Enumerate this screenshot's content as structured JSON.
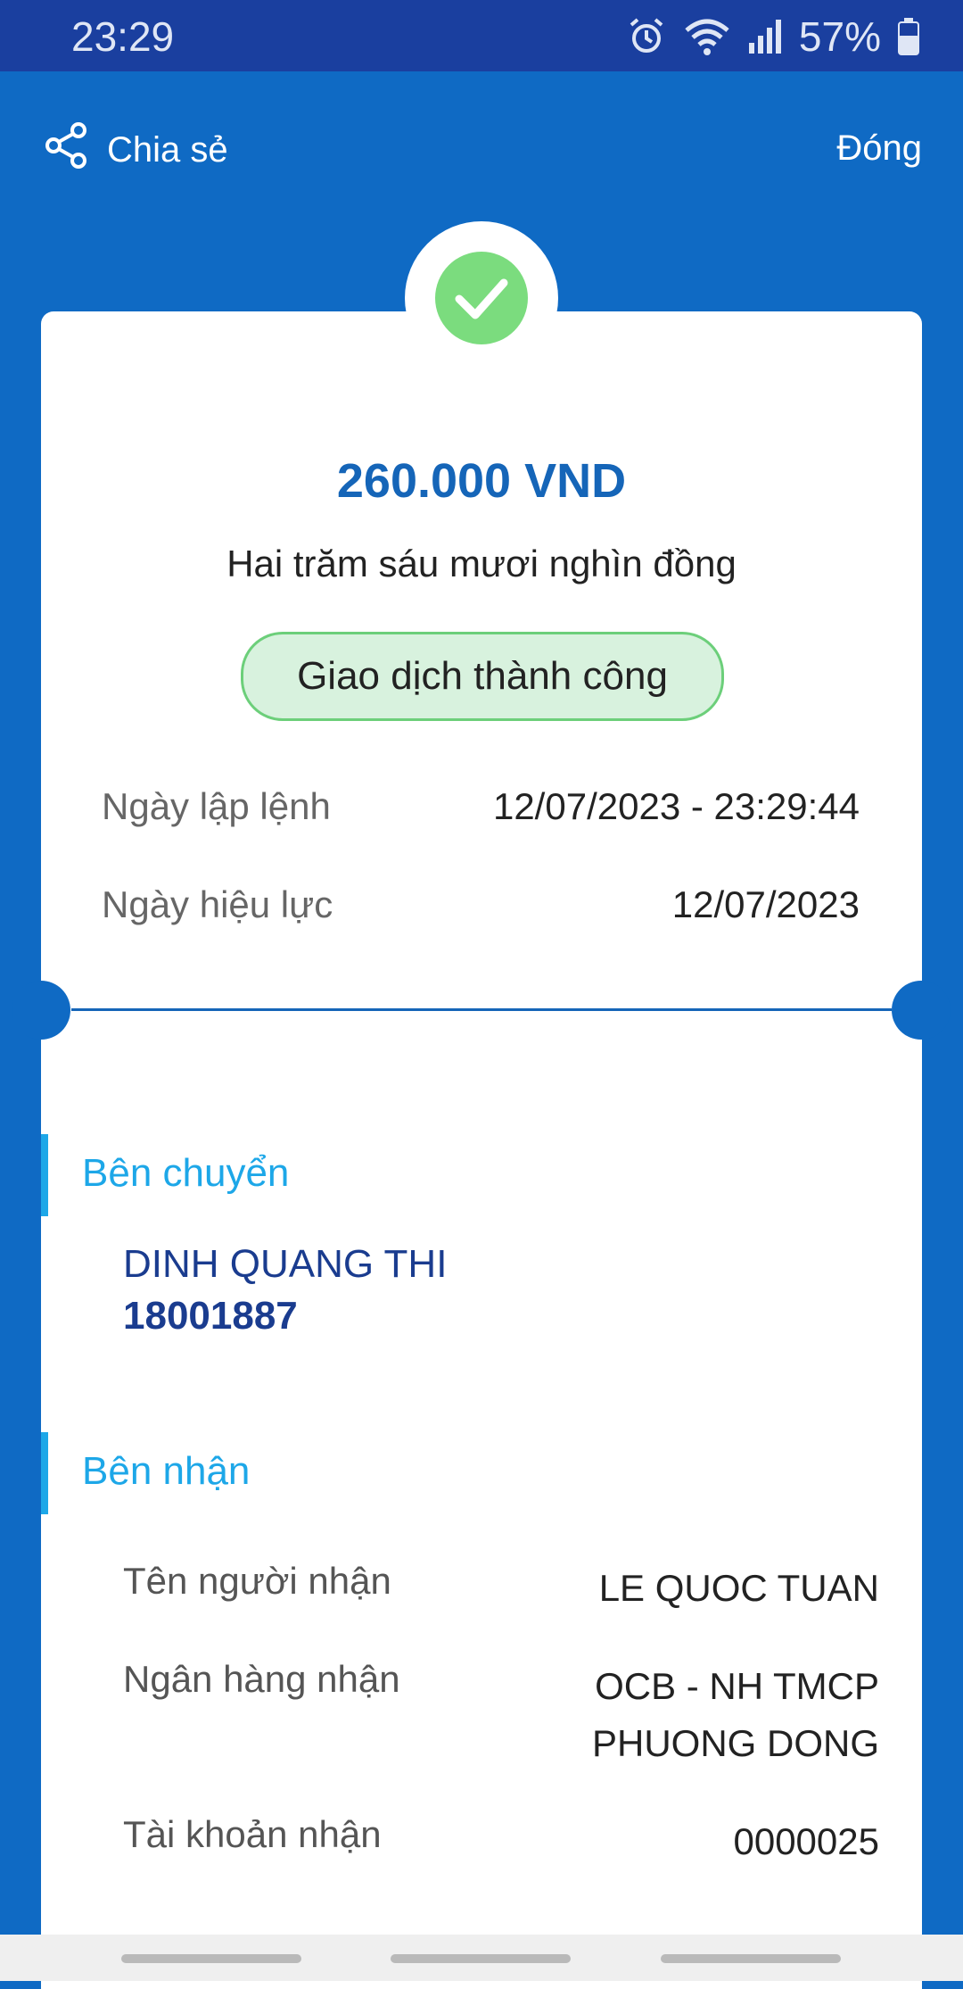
{
  "status_bar": {
    "time": "23:29",
    "battery": "57%",
    "icons": [
      "alarm-icon",
      "wifi-icon",
      "signal-icon",
      "battery-icon"
    ]
  },
  "header": {
    "share_label": "Chia sẻ",
    "close_label": "Đóng"
  },
  "receipt": {
    "amount": "260.000 VND",
    "amount_words": "Hai trăm sáu mươi nghìn đồng",
    "status": "Giao dịch thành công",
    "rows": [
      {
        "label": "Ngày lập lệnh",
        "value": "12/07/2023 - 23:29:44"
      },
      {
        "label": "Ngày hiệu lực",
        "value": "12/07/2023"
      }
    ]
  },
  "sender": {
    "title": "Bên chuyển",
    "name": "DINH QUANG THI",
    "account": "18001887"
  },
  "receiver": {
    "title": "Bên nhận",
    "rows": [
      {
        "label": "Tên người nhận",
        "value": "LE QUOC TUAN"
      },
      {
        "label": "Ngân hàng nhận",
        "value_line1": "OCB - NH TMCP",
        "value_line2": "PHUONG DONG"
      },
      {
        "label": "Tài khoản nhận",
        "value": "0000025"
      }
    ]
  },
  "colors": {
    "background": "#0f6ac4",
    "status_bar": "#1a3f9f",
    "amount": "#1565b8",
    "success": "#7bdc7e",
    "section_accent": "#1da7e8",
    "sender_text": "#1a3c8f"
  }
}
